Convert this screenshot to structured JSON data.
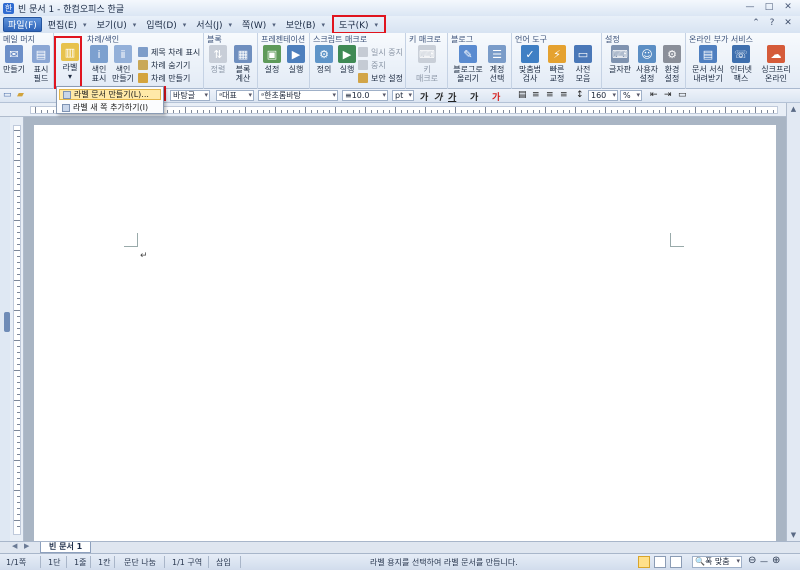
{
  "window": {
    "title": "빈 문서 1 - 한컴오피스 한글",
    "app_icon": "한"
  },
  "menu": {
    "items": [
      {
        "label": "파일(F)",
        "active": true
      },
      {
        "label": "편집(E)"
      },
      {
        "label": "보기(U)"
      },
      {
        "label": "입력(D)"
      },
      {
        "label": "서식(J)"
      },
      {
        "label": "쪽(W)"
      },
      {
        "label": "보안(B)"
      },
      {
        "label": "도구(K)",
        "highlight": true
      }
    ]
  },
  "ribbon": {
    "groups": {
      "mail_merge": "메일 머지",
      "toc_index": "차례/색인",
      "block": "블록",
      "presentation": "프레젠테이션",
      "script_macro": "스크립트 매크로",
      "keymacro": "키 매크로",
      "blog": "블로그",
      "language": "언어 도구",
      "settings": "설정",
      "online": "온라인 부가 서비스"
    },
    "buttons": {
      "create": "만들기",
      "show_field": "표시",
      "show_field_2": "필드",
      "label": "라벨",
      "index_show": "색인",
      "index_show_2": "표시",
      "index_create": "색인",
      "index_create_2": "만들기",
      "title_toc_show": "제목 차례 표시",
      "toc_hide": "차례 숨기기",
      "toc_create": "차례 만들기",
      "sort": "정렬",
      "block_calc": "블록",
      "block_calc_2": "계산",
      "pres_setting": "설정",
      "pres_run": "실행",
      "define": "정의",
      "run": "실행",
      "pause": "일시 중지",
      "stop": "중지",
      "security_setting": "보안 설정",
      "key": "키",
      "key_2": "매크로",
      "blog_post": "블로그로",
      "blog_post_2": "올리기",
      "account_select": "계정",
      "account_select_2": "선택",
      "spell": "맞춤법",
      "spell_2": "검사",
      "quick_correct": "빠른",
      "quick_correct_2": "교정",
      "dictionary": "사전",
      "dictionary_2": "모음",
      "glyph": "글자판",
      "user_setting": "사용자",
      "user_setting_2": "설정",
      "env_setting": "환경",
      "env_setting_2": "설정",
      "doc_template": "문서 서식",
      "doc_template_2": "내려받기",
      "internet_fax": "인터넷",
      "internet_fax_2": "팩스",
      "sync": "싱크프리",
      "sync_2": "온라인"
    }
  },
  "dropdown": {
    "items": [
      {
        "label": "라벨 문서 만들기(L)...",
        "selected": true
      },
      {
        "label": "라벨 새 쪽 추가하기(I)"
      }
    ]
  },
  "format_bar": {
    "style": "바탕글",
    "lang": "대표",
    "font": "한초롬바탕",
    "size": "10.0",
    "unit": "pt",
    "bold": "가",
    "italic": "가",
    "underline": "가",
    "strike": "가",
    "color": "가",
    "zoom": "160",
    "zoom_unit": "%"
  },
  "document": {
    "tab_name": "빈 문서 1",
    "paragraph_mark": "↵"
  },
  "status": {
    "page": "1/1쪽",
    "section": "1단",
    "line": "1줄",
    "column": "1칸",
    "break": "문단 나눔",
    "area": "1/1 구역",
    "mode": "삽입",
    "message": "라벨 용지를 선택하여 라벨 문서를 만듭니다.",
    "zoom": "폭 맞춤"
  }
}
